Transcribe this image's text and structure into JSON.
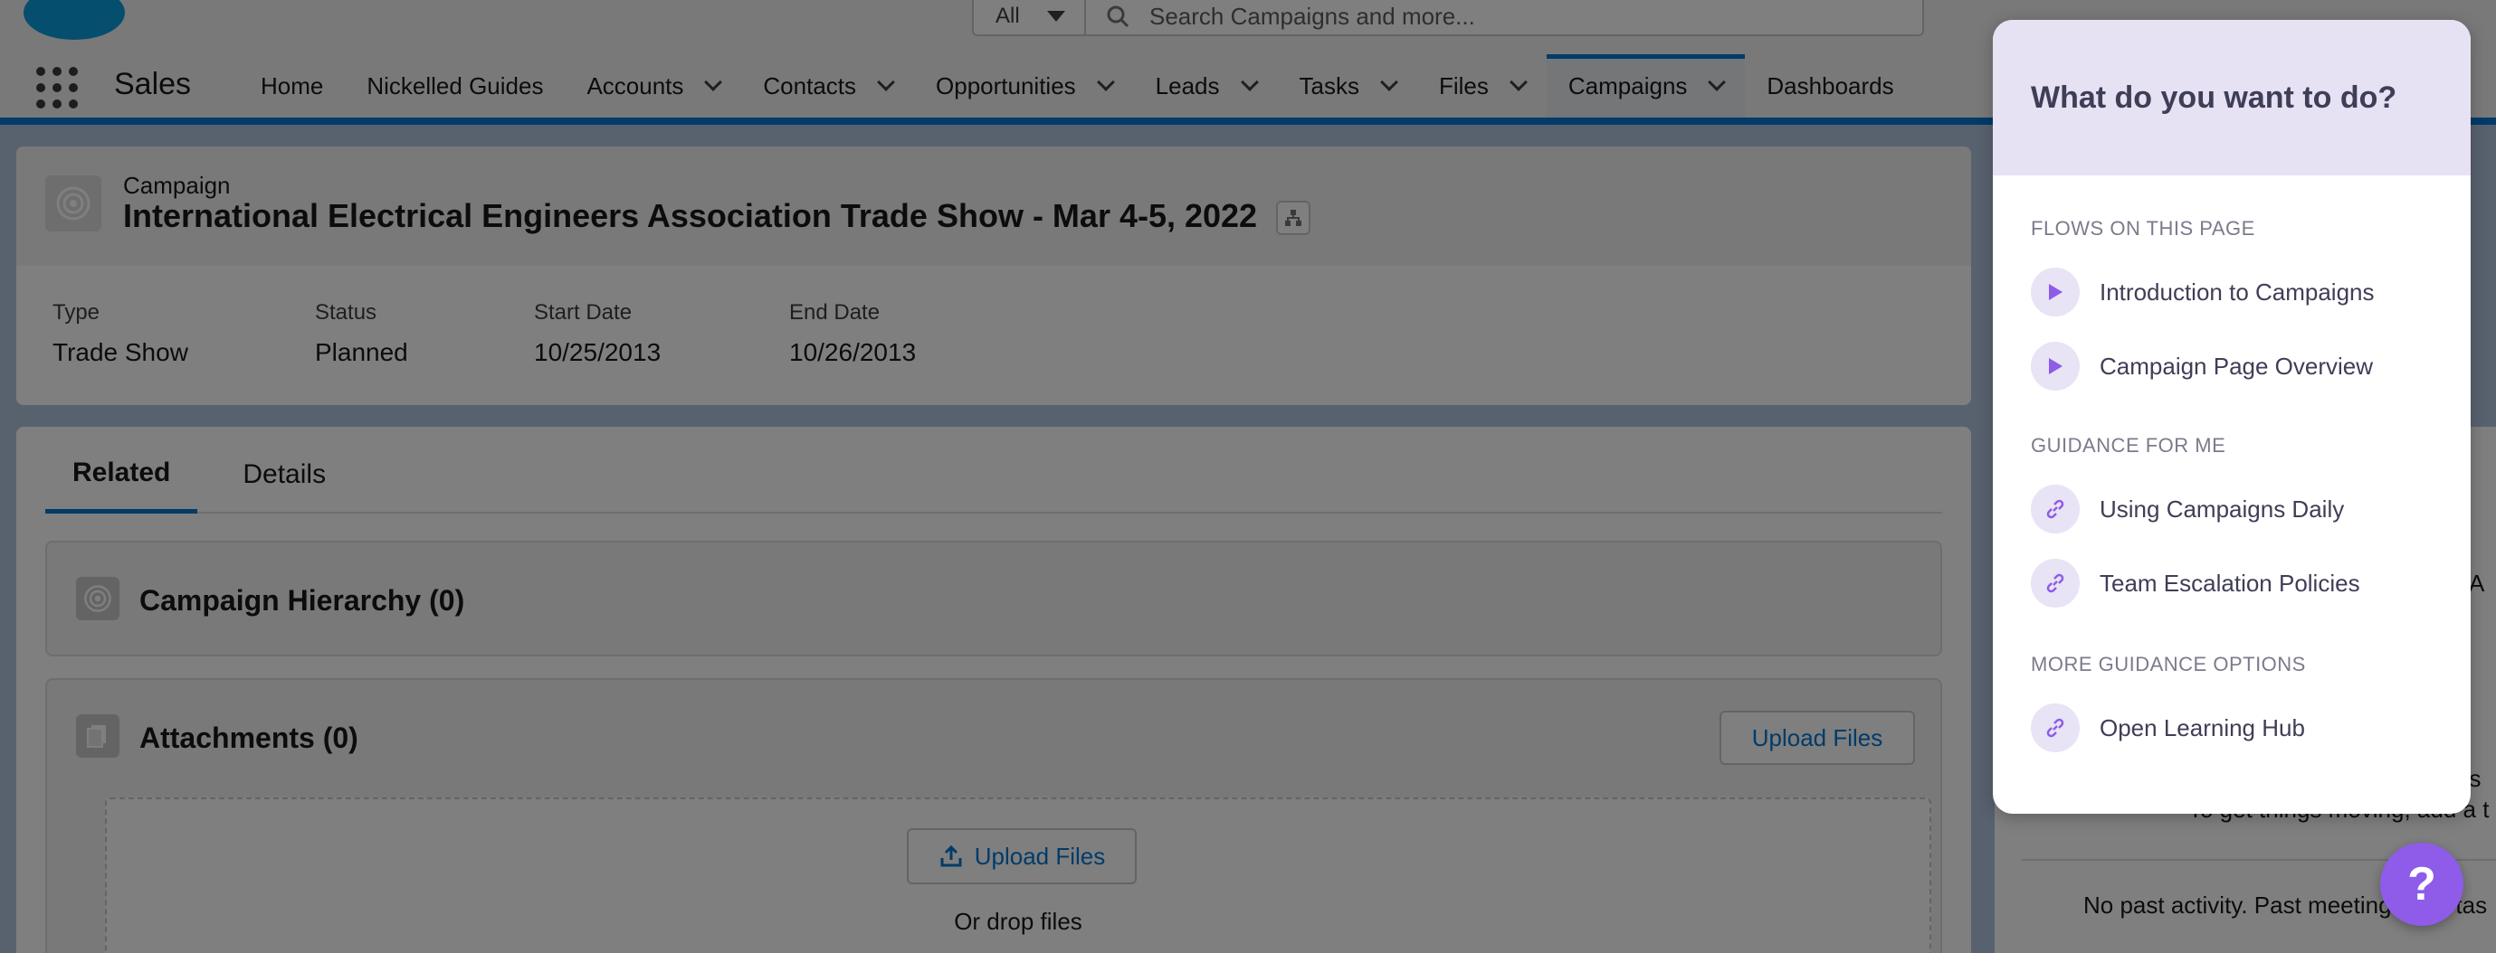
{
  "header": {
    "search_scope": "All",
    "search_placeholder": "Search Campaigns and more..."
  },
  "nav": {
    "app_name": "Sales",
    "items": [
      {
        "label": "Home",
        "has_menu": false
      },
      {
        "label": "Nickelled Guides",
        "has_menu": false
      },
      {
        "label": "Accounts",
        "has_menu": true
      },
      {
        "label": "Contacts",
        "has_menu": true
      },
      {
        "label": "Opportunities",
        "has_menu": true
      },
      {
        "label": "Leads",
        "has_menu": true
      },
      {
        "label": "Tasks",
        "has_menu": true
      },
      {
        "label": "Files",
        "has_menu": true
      },
      {
        "label": "Campaigns",
        "has_menu": true,
        "active": true
      },
      {
        "label": "Dashboards",
        "has_menu": false
      }
    ]
  },
  "record": {
    "object_label": "Campaign",
    "title": "International Electrical Engineers Association Trade Show - Mar 4-5, 2022",
    "fields": [
      {
        "label": "Type",
        "value": "Trade Show"
      },
      {
        "label": "Status",
        "value": "Planned"
      },
      {
        "label": "Start Date",
        "value": "10/25/2013"
      },
      {
        "label": "End Date",
        "value": "10/26/2013"
      }
    ]
  },
  "tabs": [
    {
      "label": "Related",
      "active": true
    },
    {
      "label": "Details",
      "active": false
    }
  ],
  "related": {
    "hierarchy_title": "Campaign Hierarchy (0)",
    "attachments_title": "Attachments (0)",
    "upload_files_label": "Upload Files",
    "drop_upload_label": "Upload Files",
    "drop_text": "Or drop files"
  },
  "side_panel": {
    "partial_1": "s: A",
    "partial_2": "t s",
    "partial_3": "To get things moving, add a t",
    "partial_4": "No past activity. Past meetings and tas"
  },
  "guidance": {
    "title": "What do you want to do?",
    "sections": [
      {
        "label": "FLOWS ON THIS PAGE",
        "items": [
          {
            "label": "Introduction to Campaigns",
            "icon": "play-icon"
          },
          {
            "label": "Campaign Page Overview",
            "icon": "play-icon"
          }
        ]
      },
      {
        "label": "GUIDANCE FOR ME",
        "items": [
          {
            "label": "Using Campaigns Daily",
            "icon": "link-icon"
          },
          {
            "label": "Team Escalation Policies",
            "icon": "link-icon"
          }
        ]
      },
      {
        "label": "MORE GUIDANCE OPTIONS",
        "items": [
          {
            "label": "Open Learning Hub",
            "icon": "link-icon"
          }
        ]
      }
    ]
  },
  "help_button": {
    "label": "?"
  },
  "colors": {
    "brand_blue": "#0176d3",
    "guide_accent": "#8e5ce8",
    "guide_header_bg": "#e6e1f3"
  }
}
